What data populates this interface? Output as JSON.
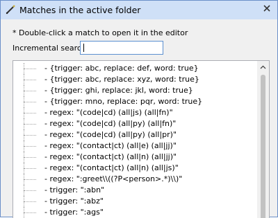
{
  "window": {
    "title": "Matches in the active folder",
    "close_symbol": "✕",
    "icon": "pen-icon"
  },
  "hint": "* Double-click a match to open it in the editor",
  "search": {
    "label": "Incremental search",
    "value": ""
  },
  "matches": [
    "- {trigger: abc, replace: def, word: true}",
    "- {trigger: abc, replace: xyz, word: true}",
    "- {trigger: ghi, replace: jkl, word: true}",
    "- {trigger: mno, replace: pqr, word: true}",
    "- regex: \"(code|cd) (all|js) (all|fn)\"",
    "- regex: \"(code|cd) (all|py) (all|fn)\"",
    "- regex: \"(code|cd) (all|py) (all|pr)\"",
    "- regex: \"(contact|ct) (all|e) (all|jj)\"",
    "- regex: \"(contact|ct) (all|n) (all|jj)\"",
    "- regex: \"(contact|ct) (all|n) (all|js)\"",
    "- regex: \":greet\\\\((?P<person>.*)\\\\)\"",
    "- trigger: \":abn\"",
    "- trigger: \":abz\"",
    "- trigger: \":ags\""
  ],
  "scrollbar": {
    "up_symbol": "^"
  },
  "colors": {
    "titlebar": "#cfe0f7",
    "window_border": "#6a8fc8",
    "input_border": "#5a8fd0"
  }
}
